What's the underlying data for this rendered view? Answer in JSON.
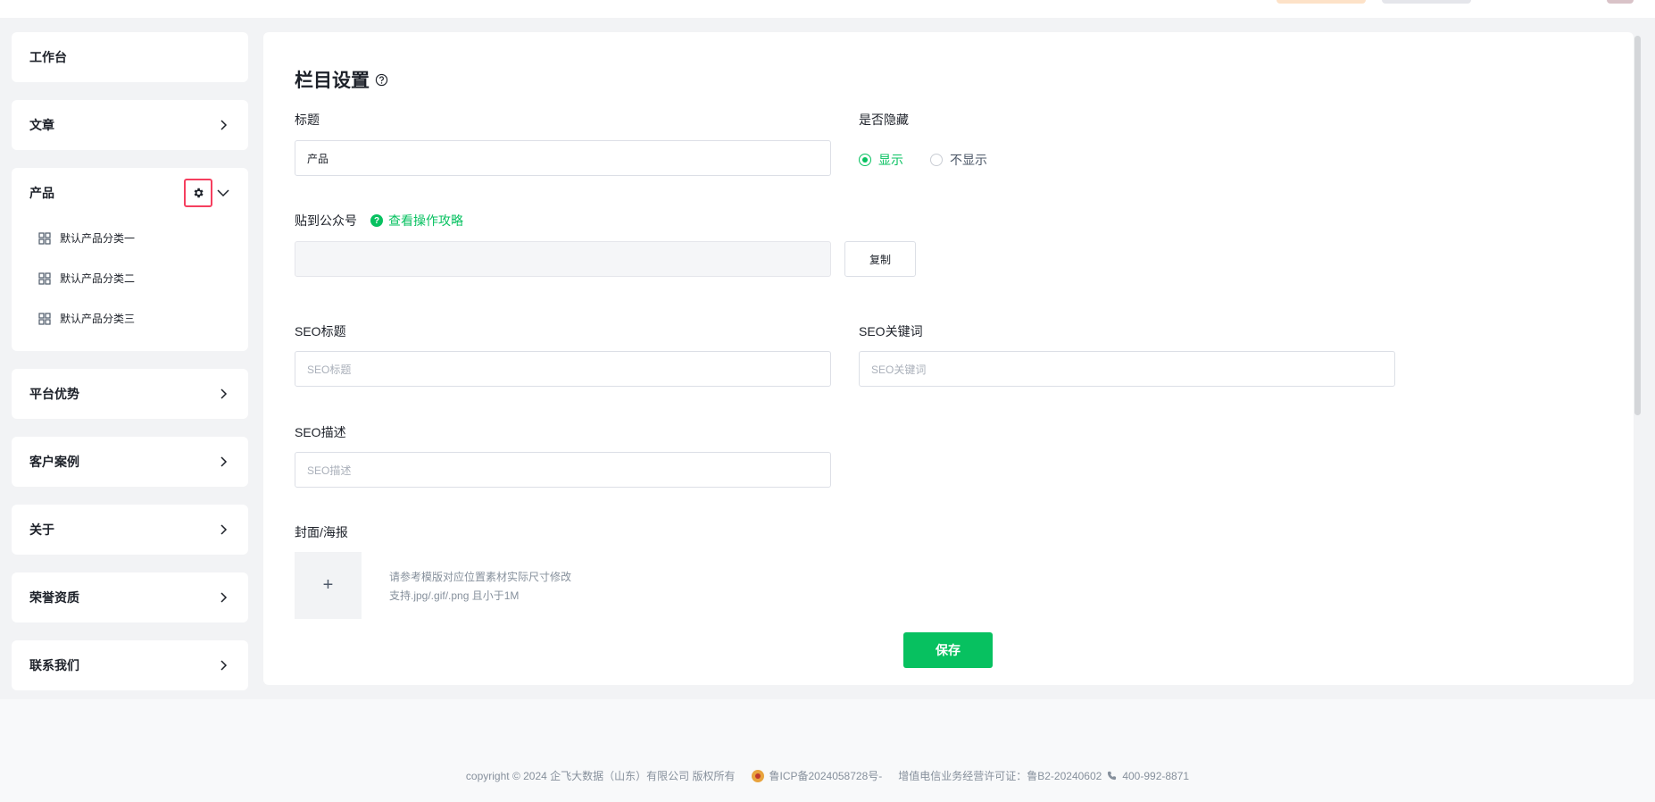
{
  "sidebar": {
    "items": [
      {
        "label": "工作台"
      },
      {
        "label": "文章"
      },
      {
        "label": "产品",
        "children": [
          "默认产品分类一",
          "默认产品分类二",
          "默认产品分类三"
        ]
      },
      {
        "label": "平台优势"
      },
      {
        "label": "客户案例"
      },
      {
        "label": "关于"
      },
      {
        "label": "荣誉资质"
      },
      {
        "label": "联系我们"
      }
    ]
  },
  "form": {
    "page_title": "栏目设置",
    "title_label": "标题",
    "title_value": "产品",
    "hidden_label": "是否隐藏",
    "hidden_options": [
      "显示",
      "不显示"
    ],
    "hidden_selected": "显示",
    "wechat_label": "贴到公众号",
    "wechat_guide": "查看操作攻略",
    "wechat_value": "",
    "copy_label": "复制",
    "seo_title_label": "SEO标题",
    "seo_title_placeholder": "SEO标题",
    "seo_keywords_label": "SEO关键词",
    "seo_keywords_placeholder": "SEO关键词",
    "seo_desc_label": "SEO描述",
    "seo_desc_placeholder": "SEO描述",
    "cover_label": "封面/海报",
    "upload_symbol": "+",
    "cover_hint_1": "请参考模版对应位置素材实际尺寸修改",
    "cover_hint_2": "支持.jpg/.gif/.png 且小于1M",
    "save_label": "保存"
  },
  "footer": {
    "copyright": "copyright © 2024 企飞大数据（山东）有限公司 版权所有",
    "icp": "鲁ICP备2024058728号-",
    "license": "增值电信业务经营许可证：鲁B2-20240602",
    "phone": "400-992-8871"
  },
  "colors": {
    "accent": "#07c160",
    "highlight": "#f53f5f"
  }
}
